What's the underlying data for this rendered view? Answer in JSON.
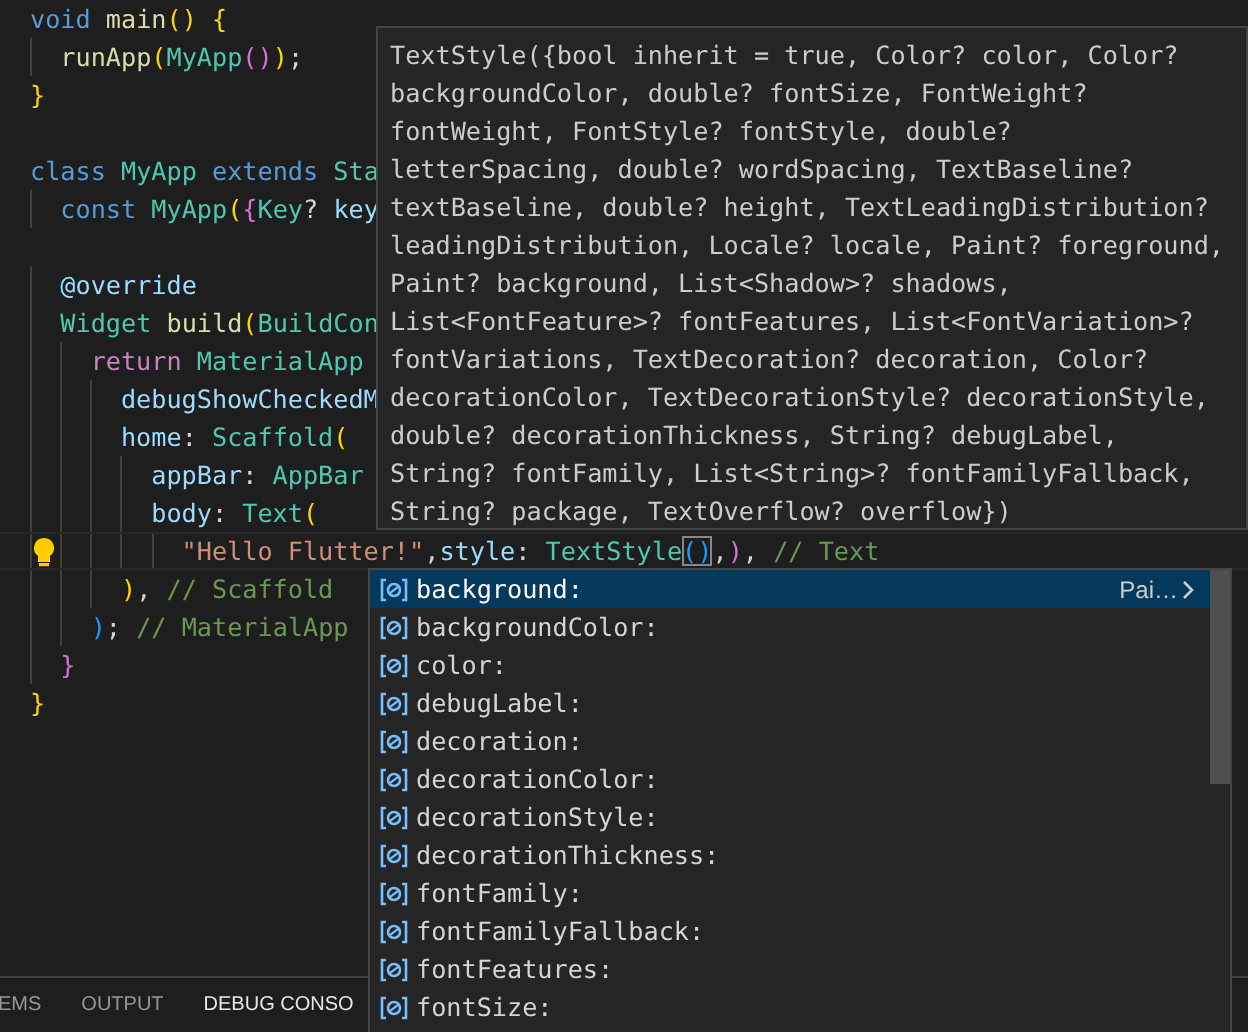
{
  "editor": {
    "lines": [
      {
        "kind": "code",
        "current": false,
        "tokens": [
          {
            "kind": "keyword",
            "text": "void "
          },
          {
            "kind": "function",
            "text": "main"
          },
          {
            "kind": "bracket1",
            "text": "() {"
          }
        ]
      },
      {
        "kind": "code",
        "current": false,
        "tokens": [
          {
            "kind": "function",
            "text": "  runApp"
          },
          {
            "kind": "bracket1",
            "text": "("
          },
          {
            "kind": "type",
            "text": "MyApp"
          },
          {
            "kind": "bracket2",
            "text": "()"
          },
          {
            "kind": "bracket1",
            "text": ")"
          },
          {
            "kind": "plain",
            "text": ";"
          }
        ]
      },
      {
        "kind": "code",
        "current": false,
        "tokens": [
          {
            "kind": "bracket1",
            "text": "}"
          }
        ]
      },
      {
        "kind": "blank"
      },
      {
        "kind": "code",
        "current": false,
        "tokens": [
          {
            "kind": "keyword",
            "text": "class "
          },
          {
            "kind": "type",
            "text": "MyApp "
          },
          {
            "kind": "keyword",
            "text": "extends "
          },
          {
            "kind": "type",
            "text": "Sta"
          }
        ]
      },
      {
        "kind": "code",
        "current": false,
        "tokens": [
          {
            "kind": "keyword",
            "text": "  const "
          },
          {
            "kind": "type",
            "text": "MyApp"
          },
          {
            "kind": "bracket1",
            "text": "("
          },
          {
            "kind": "bracket2",
            "text": "{"
          },
          {
            "kind": "type",
            "text": "Key"
          },
          {
            "kind": "plain",
            "text": "? "
          },
          {
            "kind": "property",
            "text": "key"
          }
        ]
      },
      {
        "kind": "blank"
      },
      {
        "kind": "code",
        "current": false,
        "tokens": [
          {
            "kind": "property",
            "text": "  @override"
          }
        ]
      },
      {
        "kind": "code",
        "current": false,
        "tokens": [
          {
            "kind": "type",
            "text": "  Widget "
          },
          {
            "kind": "function",
            "text": "build"
          },
          {
            "kind": "bracket1",
            "text": "("
          },
          {
            "kind": "type",
            "text": "BuildCon"
          }
        ]
      },
      {
        "kind": "code",
        "current": false,
        "tokens": [
          {
            "kind": "control",
            "text": "    return "
          },
          {
            "kind": "type",
            "text": "MaterialApp"
          }
        ]
      },
      {
        "kind": "code",
        "current": false,
        "tokens": [
          {
            "kind": "property",
            "text": "      debugShowCheckedM"
          }
        ]
      },
      {
        "kind": "code",
        "current": false,
        "tokens": [
          {
            "kind": "property",
            "text": "      home"
          },
          {
            "kind": "plain",
            "text": ": "
          },
          {
            "kind": "type",
            "text": "Scaffold"
          },
          {
            "kind": "bracket1",
            "text": "("
          }
        ]
      },
      {
        "kind": "code",
        "current": false,
        "tokens": [
          {
            "kind": "property",
            "text": "        appBar"
          },
          {
            "kind": "plain",
            "text": ": "
          },
          {
            "kind": "type",
            "text": "AppBar"
          }
        ]
      },
      {
        "kind": "code",
        "current": false,
        "tokens": [
          {
            "kind": "property",
            "text": "        body"
          },
          {
            "kind": "plain",
            "text": ": "
          },
          {
            "kind": "type",
            "text": "Text"
          },
          {
            "kind": "bracket1",
            "text": "("
          }
        ]
      },
      {
        "kind": "code",
        "current": true,
        "tokens": [
          {
            "kind": "string",
            "text": "          \"Hello Flutter!\""
          },
          {
            "kind": "plain",
            "text": ","
          },
          {
            "kind": "property",
            "text": "style"
          },
          {
            "kind": "plain",
            "text": ": "
          },
          {
            "kind": "type",
            "text": "TextStyle"
          },
          {
            "kind": "match",
            "text": "()"
          },
          {
            "kind": "plain",
            "text": ","
          },
          {
            "kind": "bracket2",
            "text": ")"
          },
          {
            "kind": "plain",
            "text": ", "
          },
          {
            "kind": "comment",
            "text": "// Text"
          }
        ]
      },
      {
        "kind": "code",
        "current": false,
        "tokens": [
          {
            "kind": "bracket1",
            "text": "      )"
          },
          {
            "kind": "plain",
            "text": ", "
          },
          {
            "kind": "comment",
            "text": "// Scaffold"
          }
        ]
      },
      {
        "kind": "code",
        "current": false,
        "tokens": [
          {
            "kind": "bracket3",
            "text": "    )"
          },
          {
            "kind": "plain",
            "text": "; "
          },
          {
            "kind": "comment",
            "text": "// MaterialApp"
          }
        ]
      },
      {
        "kind": "code",
        "current": false,
        "tokens": [
          {
            "kind": "bracket2",
            "text": "  }"
          }
        ]
      },
      {
        "kind": "code",
        "current": false,
        "tokens": [
          {
            "kind": "bracket1",
            "text": "}"
          }
        ]
      }
    ],
    "hover": {
      "signature": "TextStyle({bool inherit = true, Color? color, Color?\nbackgroundColor, double? fontSize, FontWeight?\nfontWeight, FontStyle? fontStyle, double?\nletterSpacing, double? wordSpacing, TextBaseline?\ntextBaseline, double? height, TextLeadingDistribution?\nleadingDistribution, Locale? locale, Paint? foreground,\nPaint? background, List<Shadow>? shadows,\nList<FontFeature>? fontFeatures, List<FontVariation>?\nfontVariations, TextDecoration? decoration, Color?\ndecorationColor, TextDecorationStyle? decorationStyle,\ndouble? decorationThickness, String? debugLabel,\nString? fontFamily, List<String>? fontFamilyFallback,\nString? package, TextOverflow? overflow})"
    },
    "suggestions": [
      {
        "label": "background:",
        "selected": true,
        "detail": "Pai…"
      },
      {
        "label": "backgroundColor:",
        "selected": false
      },
      {
        "label": "color:",
        "selected": false
      },
      {
        "label": "debugLabel:",
        "selected": false
      },
      {
        "label": "decoration:",
        "selected": false
      },
      {
        "label": "decorationColor:",
        "selected": false
      },
      {
        "label": "decorationStyle:",
        "selected": false
      },
      {
        "label": "decorationThickness:",
        "selected": false
      },
      {
        "label": "fontFamily:",
        "selected": false
      },
      {
        "label": "fontFamilyFallback:",
        "selected": false
      },
      {
        "label": "fontFeatures:",
        "selected": false
      },
      {
        "label": "fontSize:",
        "selected": false
      }
    ]
  },
  "panel": {
    "tabs": [
      {
        "label": "EMS",
        "selected": false
      },
      {
        "label": "OUTPUT",
        "selected": false
      },
      {
        "label": "DEBUG CONSO",
        "selected": true
      }
    ]
  }
}
